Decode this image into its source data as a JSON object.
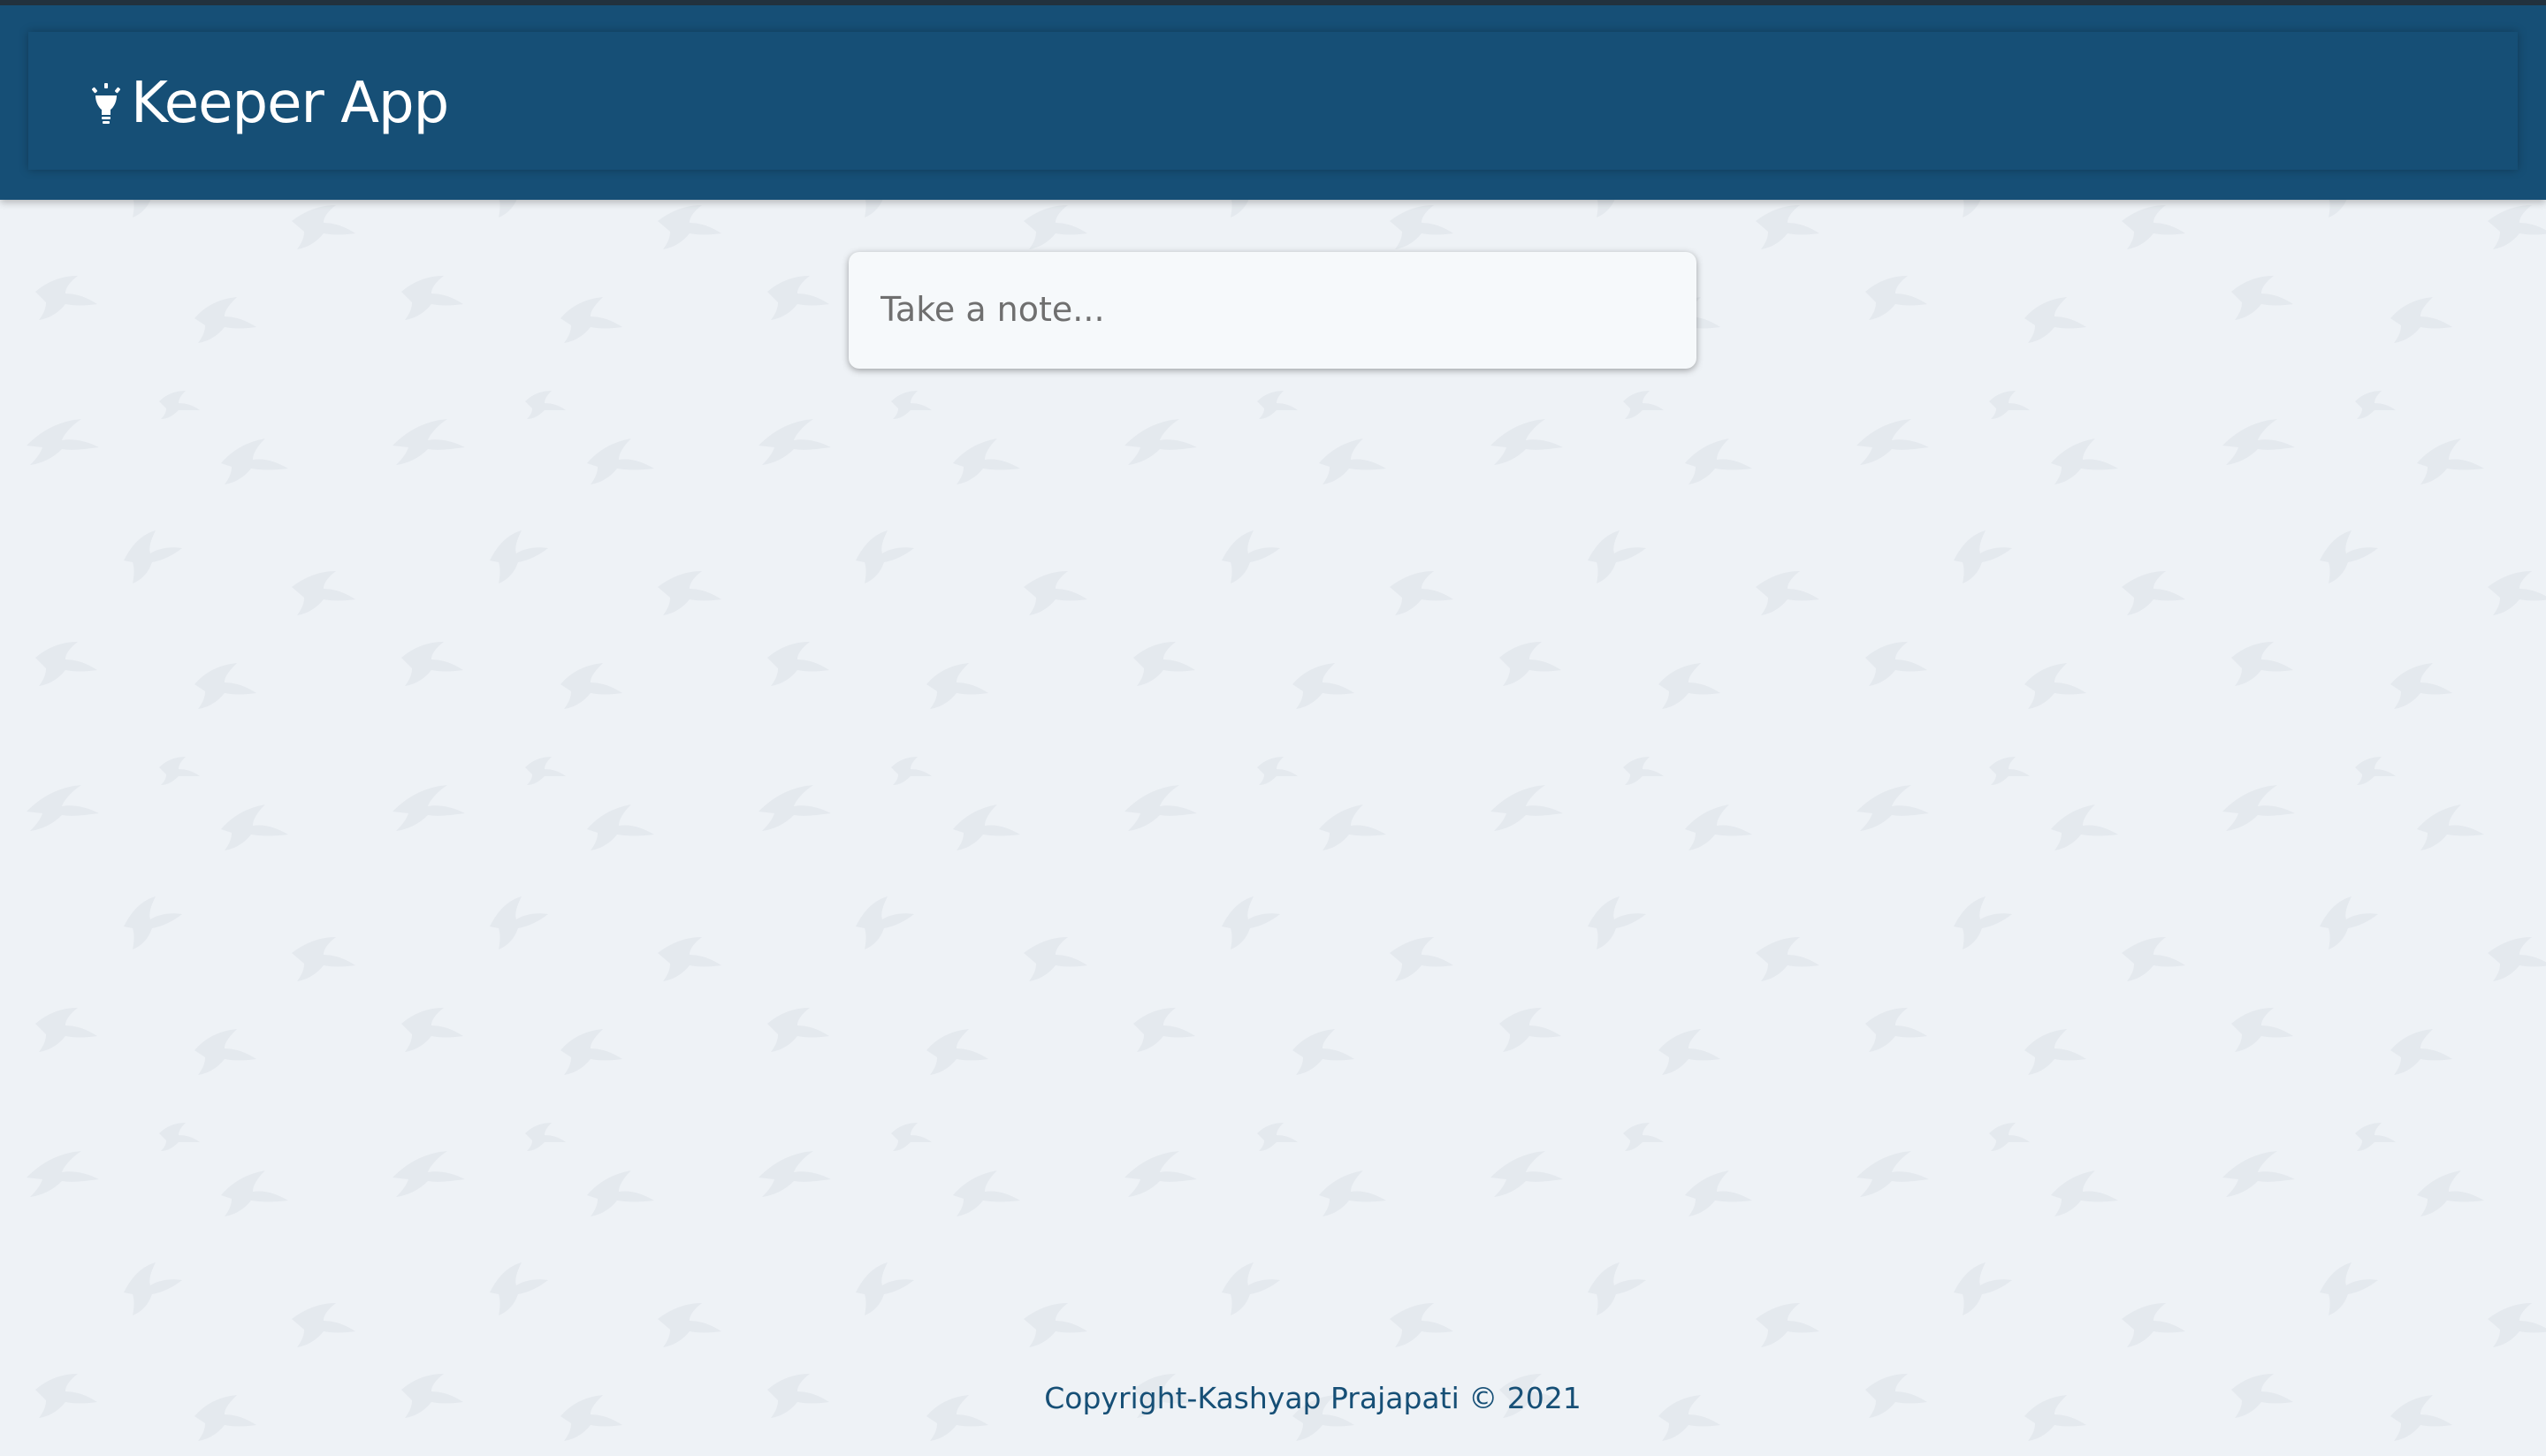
{
  "app": {
    "title": "Keeper App",
    "logo_icon": "lightbulb-icon"
  },
  "note_input": {
    "placeholder": "Take a note...",
    "value": ""
  },
  "footer": {
    "text": "Copyright-Kashyap Prajapati © 2021"
  },
  "background": {
    "pattern": "hummingbird-pattern"
  },
  "colors": {
    "header": "#164f76",
    "page_background": "#eef2f6",
    "note_box": "#f6f9fb",
    "footer_text": "#164f76",
    "header_text": "#ffffff"
  }
}
